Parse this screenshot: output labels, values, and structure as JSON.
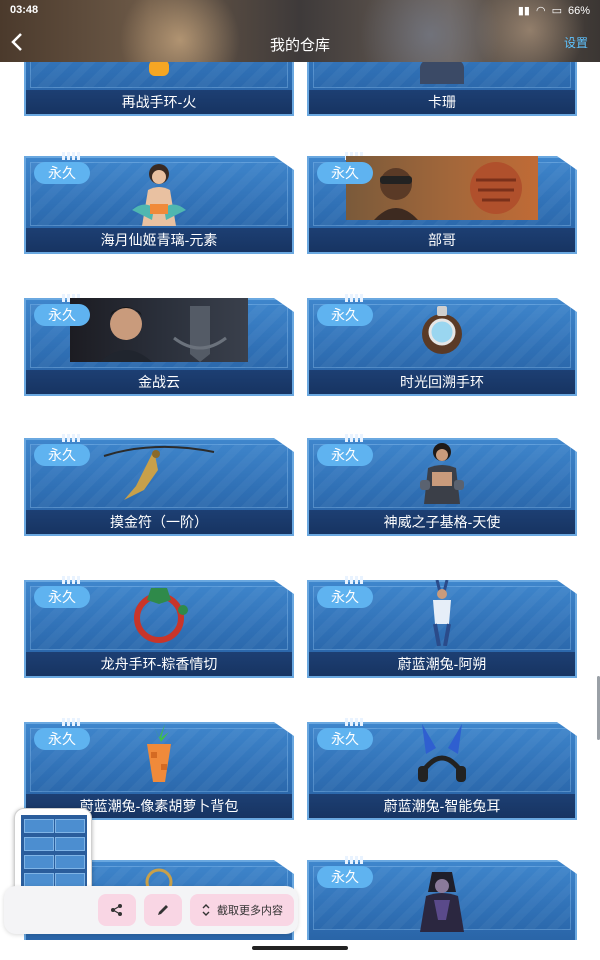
{
  "status": {
    "time": "03:48",
    "battery": "66%"
  },
  "header": {
    "title": "我的仓库",
    "settings_label": "设置"
  },
  "cards": [
    {
      "label": "再战手环-火",
      "badge": ""
    },
    {
      "label": "卡珊",
      "badge": ""
    },
    {
      "label": "海月仙姬青璃-元素",
      "badge": "永久"
    },
    {
      "label": "部哥",
      "badge": "永久"
    },
    {
      "label": "金战云",
      "badge": "永久"
    },
    {
      "label": "时光回溯手环",
      "badge": "永久"
    },
    {
      "label": "摸金符（一阶）",
      "badge": "永久"
    },
    {
      "label": "神威之子基格-天使",
      "badge": "永久"
    },
    {
      "label": "龙舟手环-粽香情切",
      "badge": "永久"
    },
    {
      "label": "蔚蓝潮兔-阿朔",
      "badge": "永久"
    },
    {
      "label": "蔚蓝潮兔-像素胡萝卜背包",
      "badge": "永久"
    },
    {
      "label": "蔚蓝潮兔-智能兔耳",
      "badge": "永久"
    },
    {
      "label": "",
      "badge": ""
    },
    {
      "label": "",
      "badge": "永久"
    }
  ],
  "toolbar": {
    "more_label": "截取更多内容"
  },
  "icons": {
    "back": "chevron-left-icon",
    "share": "share-icon",
    "edit": "pencil-icon",
    "expand": "expand-vertical-icon"
  },
  "colors": {
    "badge": "#5fb3f0",
    "card": "#2f6fb4",
    "settings": "#5ec3ff",
    "tool_button": "#f9d6e4"
  }
}
